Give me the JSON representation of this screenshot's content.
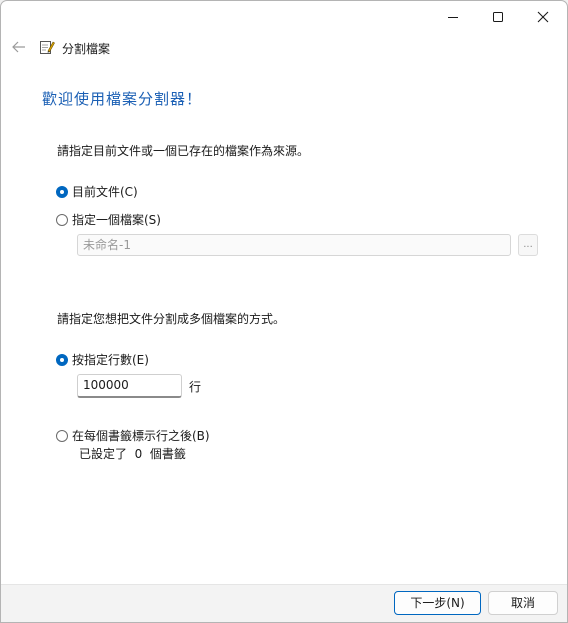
{
  "window": {
    "title": "分割檔案",
    "caption_buttons": [
      "minimize",
      "maximize",
      "close"
    ]
  },
  "heading": "歡迎使用檔案分割器！",
  "source": {
    "label": "請指定目前文件或一個已存在的檔案作為來源。",
    "option_current": "目前文件(C)",
    "option_file": "指定一個檔案(S)",
    "file_placeholder": "未命名-1",
    "browse_label": "...",
    "selected": "current"
  },
  "method": {
    "label": "請指定您想把文件分割成多個檔案的方式。",
    "option_lines": "按指定行數(E)",
    "lines_value": "100000",
    "lines_unit": "行",
    "option_bookmarks": "在每個書籤標示行之後(B)",
    "bookmark_status": "已設定了  0  個書籤",
    "selected": "lines"
  },
  "footer": {
    "next_label": "下一步(N)",
    "cancel_label": "取消"
  },
  "colors": {
    "accent": "#0067c0",
    "heading": "#1a5fb4"
  }
}
